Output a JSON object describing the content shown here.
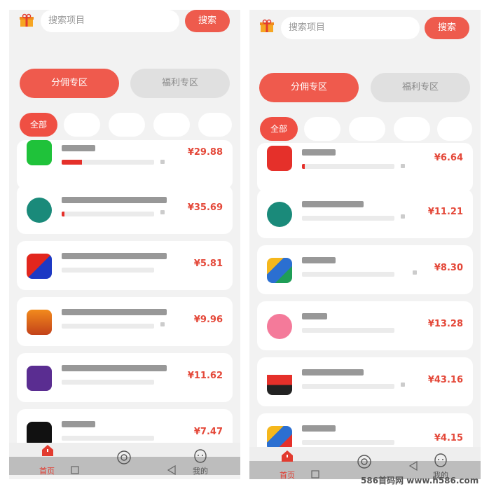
{
  "colors": {
    "accent": "#ee5b4d",
    "price": "#e44839",
    "progress": "#e5302a"
  },
  "screens": [
    {
      "search_placeholder": "搜索项目",
      "search_button": "搜索",
      "zones": [
        "分佣专区",
        "福利专区"
      ],
      "chip_all": "全部",
      "items": [
        {
          "icon": "wechat-app-icon",
          "price": "¥29.88",
          "progress": 0.22
        },
        {
          "icon": "teal-app-icon",
          "price": "¥35.69",
          "progress": 0.03
        },
        {
          "icon": "red-blue-app-icon",
          "price": "¥5.81",
          "progress": 0.0
        },
        {
          "icon": "orange-app-icon",
          "price": "¥9.96",
          "progress": 0.0
        },
        {
          "icon": "purple-app-icon",
          "price": "¥11.62",
          "progress": 0.0
        },
        {
          "icon": "tiktok-app-icon",
          "price": "¥7.47",
          "progress": 0.0
        }
      ],
      "tabs": {
        "home": "首页",
        "mine": "我的"
      }
    },
    {
      "search_placeholder": "搜索项目",
      "search_button": "搜索",
      "zones": [
        "分佣专区",
        "福利专区"
      ],
      "chip_all": "全部",
      "items": [
        {
          "icon": "red-square-app-icon",
          "price": "¥6.64",
          "progress": 0.03
        },
        {
          "icon": "teal-app-icon",
          "price": "¥11.21",
          "progress": 0.0
        },
        {
          "icon": "multicolor-app-icon",
          "price": "¥8.30",
          "progress": 0.0
        },
        {
          "icon": "pink-app-icon",
          "price": "¥13.28",
          "progress": 0.0
        },
        {
          "icon": "runner-app-icon",
          "price": "¥43.16",
          "progress": 0.0
        },
        {
          "icon": "multicolor-app-icon",
          "price": "¥4.15",
          "progress": 0.0
        }
      ],
      "tabs": {
        "home": "首页",
        "mine": "我的"
      }
    }
  ],
  "watermark": "586首码网 www.h586.com"
}
